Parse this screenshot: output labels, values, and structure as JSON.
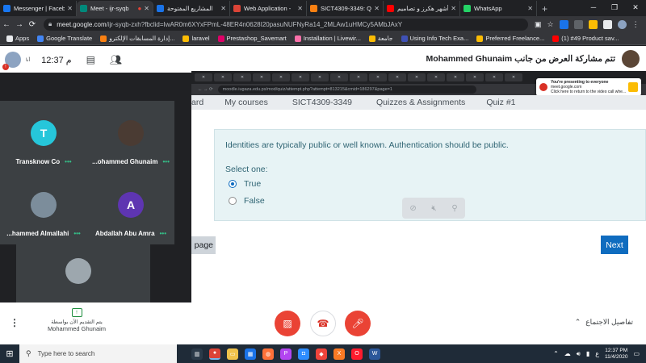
{
  "browser": {
    "tabs": [
      {
        "title": "Messenger | Facebook",
        "color": "#1877f2"
      },
      {
        "title": "Meet - ijr-syqb",
        "color": "#00897b"
      },
      {
        "title": "المشاريع المفتوحة",
        "color": "#1a73e8"
      },
      {
        "title": "Web Application -",
        "color": "#db4437"
      },
      {
        "title": "SICT4309-3349: Q",
        "color": "#f98012"
      },
      {
        "title": "أشهر هكرز و تصاميم",
        "color": "#ff0000"
      },
      {
        "title": "WhatsApp",
        "color": "#25d366"
      }
    ],
    "url_host": "meet.google.com",
    "url_path": "/ijr-syqb-zxh?fbclid=IwAR0m6XYxFPmL-48ER4n0628I20pasuNUFNyRa14_2MLAw1uHMCy5AMbJAxY",
    "bookmarks": [
      "Apps",
      "Google Translate",
      "إدارة المسابقات الإلكترو...",
      "laravel",
      "Prestashop_Savemart",
      "Installation | Livewir...",
      "جامعة",
      "Using Info Tech Exa...",
      "Preferred Freelance...",
      "(1) #49 Product sav..."
    ]
  },
  "meet": {
    "clock": "12:37 م",
    "self_short": "أنا",
    "presenting_title": "تتم مشاركة العرض من جانب Mohammed Ghunaim",
    "participants": [
      {
        "name": "Transknow Co",
        "initial": "T",
        "color": "#26c6da"
      },
      {
        "name": "...ohammed Ghunaim",
        "initial": "",
        "color": "#4a3b33"
      },
      {
        "name": "...hammed Almallahi",
        "initial": "",
        "color": "#7c8d9b"
      },
      {
        "name": "Abdallah Abu Amra",
        "initial": "A",
        "color": "#5e35b1"
      }
    ],
    "presenter_line1": "يتم التقديم الآن بواسطة",
    "presenter_name": "Mohammed Ghunaim",
    "details_label": "تفاصيل الاجتماع"
  },
  "shared": {
    "inner_url": "moodle.iugaza.edu.ps/mod/quiz/attempt.php?attempt=813215&cmid=186297&page=1",
    "presenting_line1": "You're presenting to everyone",
    "presenting_line2": "meet.google.com",
    "presenting_line3": "Click here to return to the video call whe...",
    "nav": [
      "ard",
      "My courses",
      "SICT4309-3349",
      "Quizzes & Assignments",
      "Quiz #1"
    ],
    "question": "Identities are typically public or well known. Authentication should be public.",
    "select_one": "Select one:",
    "options": [
      {
        "label": "True",
        "selected": true
      },
      {
        "label": "False",
        "selected": false
      }
    ],
    "prev_label": "page",
    "next_label": "Next"
  },
  "taskbar": {
    "search_placeholder": "Type here to search",
    "time": "12:37 PM",
    "date": "11/4/2020",
    "lang": "ع"
  }
}
